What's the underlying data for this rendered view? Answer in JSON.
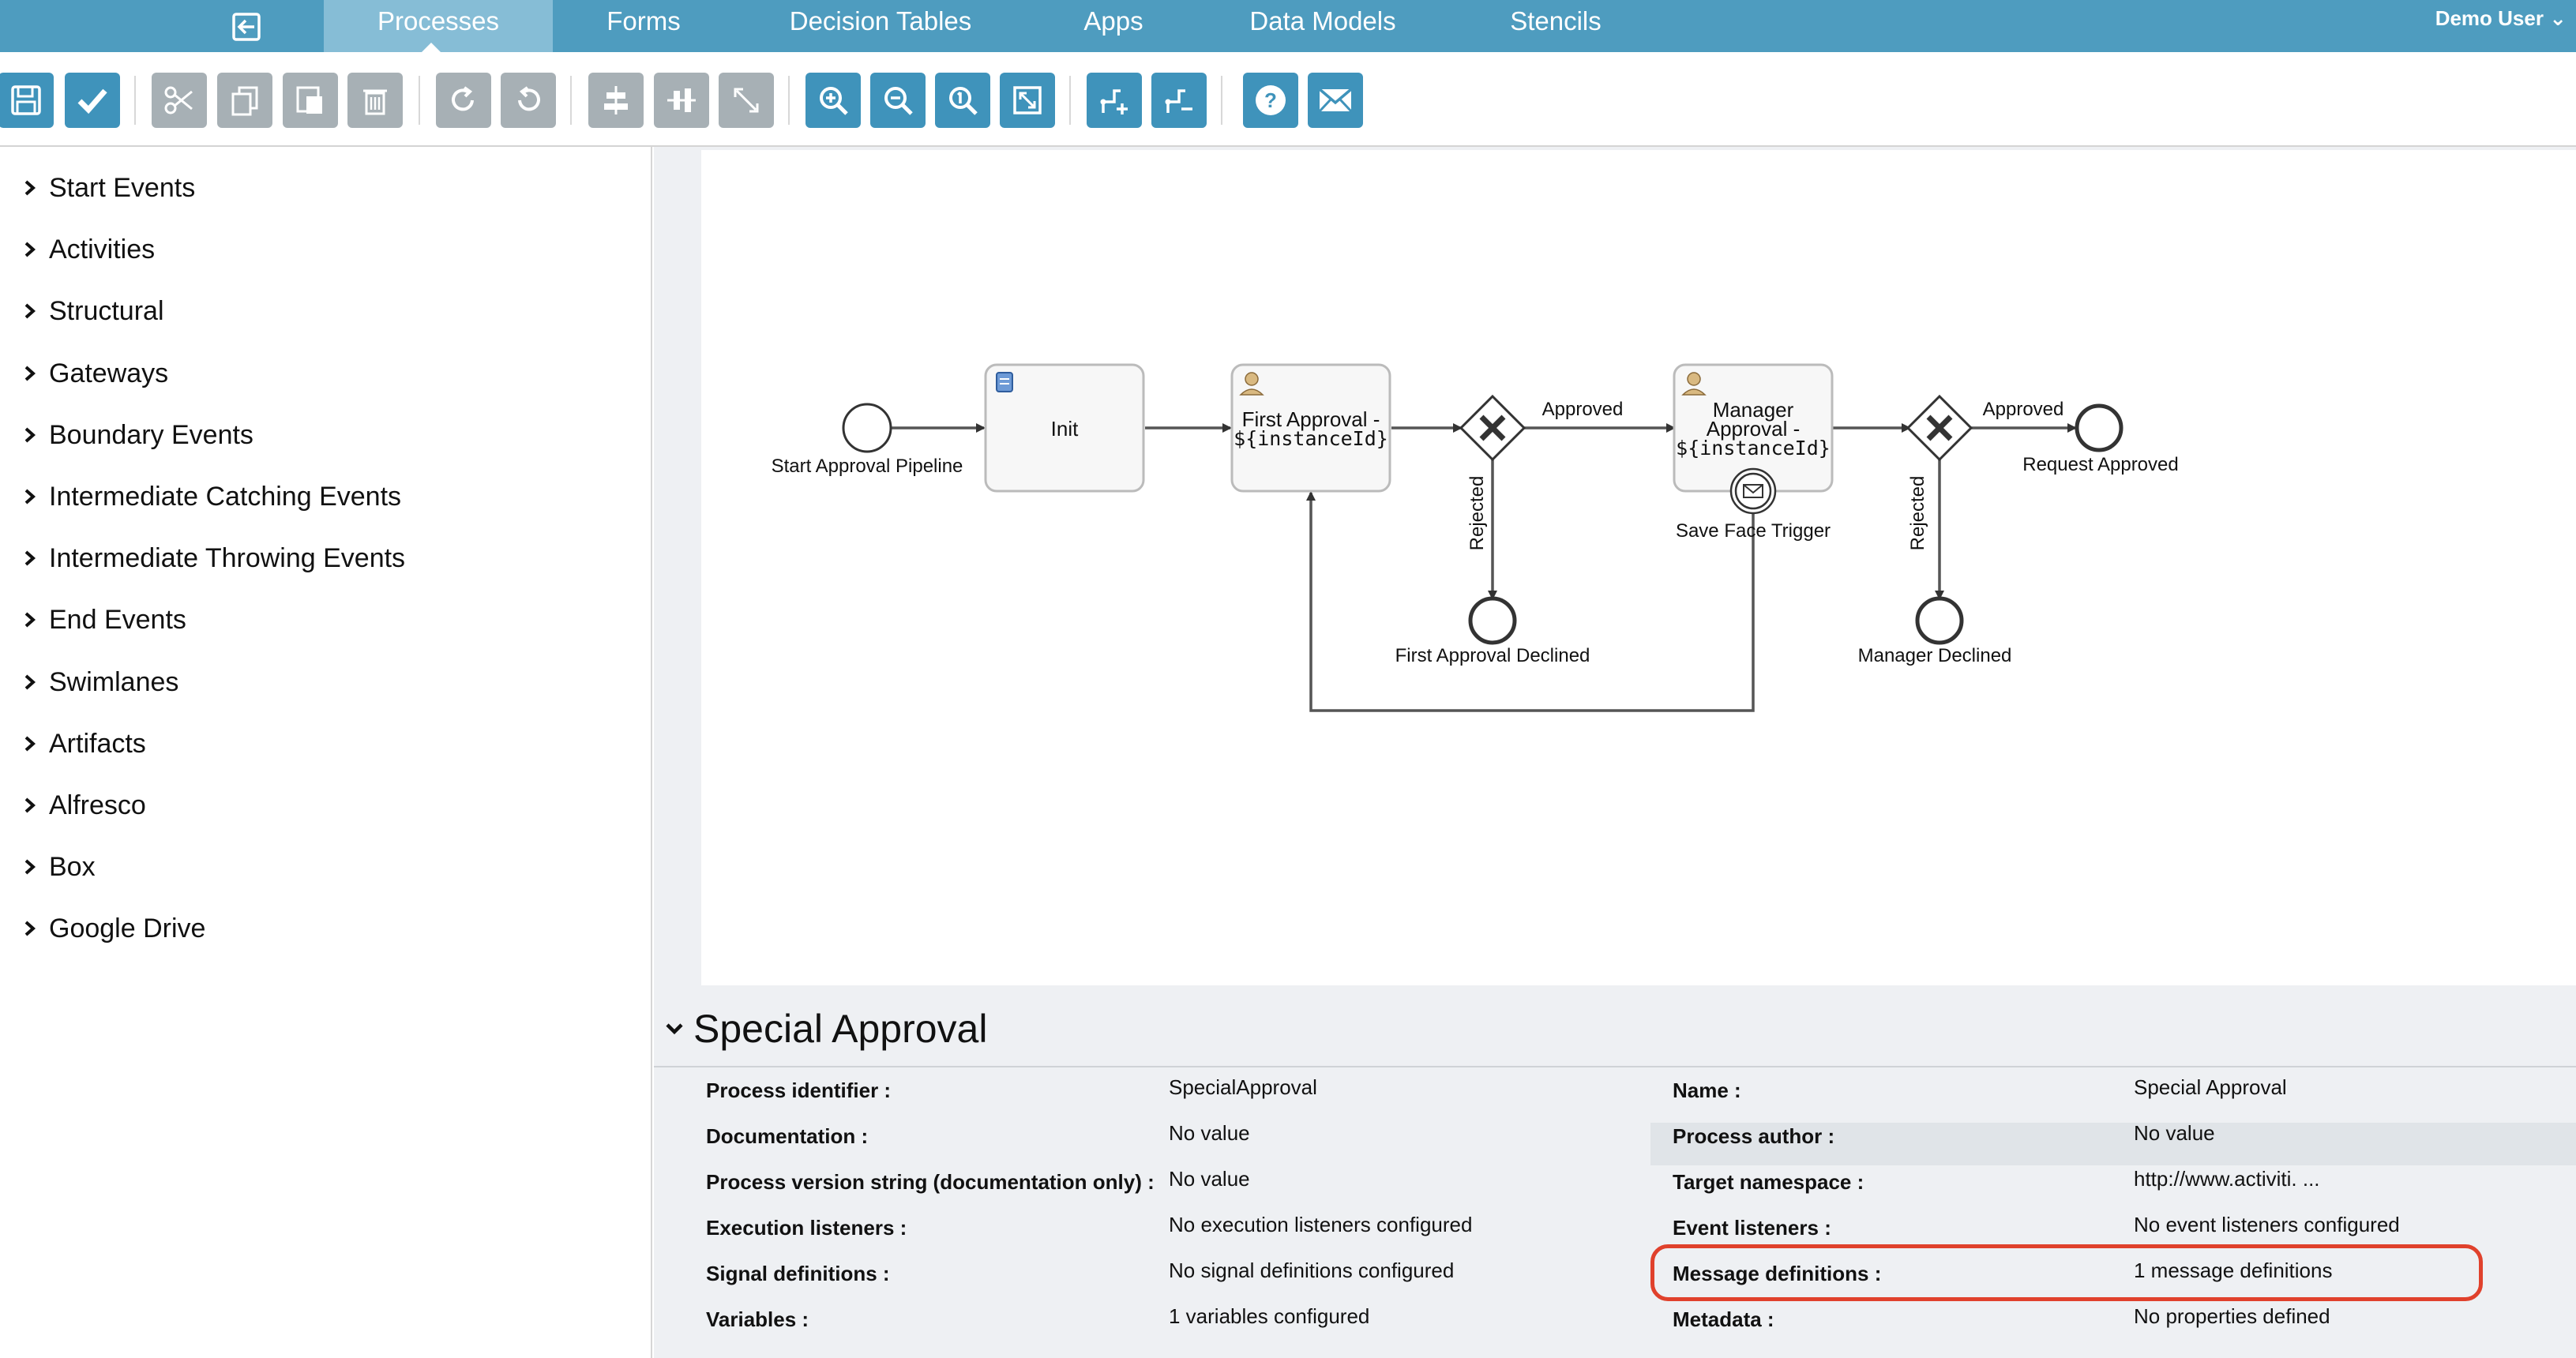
{
  "nav": {
    "tabs": [
      {
        "label": "Processes",
        "active": true
      },
      {
        "label": "Forms"
      },
      {
        "label": "Decision Tables"
      },
      {
        "label": "Apps"
      },
      {
        "label": "Data Models"
      },
      {
        "label": "Stencils"
      }
    ],
    "user": "Demo User"
  },
  "toolbar": {
    "buttons": [
      {
        "icon": "save-icon"
      },
      {
        "icon": "checkmark-icon"
      },
      {
        "icon": "scissors-icon"
      },
      {
        "icon": "copy-icon"
      },
      {
        "icon": "paste-icon"
      },
      {
        "icon": "trash-icon"
      },
      {
        "icon": "redo-icon"
      },
      {
        "icon": "undo-icon"
      },
      {
        "icon": "align-horizontal-icon"
      },
      {
        "icon": "align-vertical-icon"
      },
      {
        "icon": "resize-icon"
      },
      {
        "icon": "zoom-in-icon"
      },
      {
        "icon": "zoom-out-icon"
      },
      {
        "icon": "zoom-actual-icon"
      },
      {
        "icon": "zoom-fit-icon"
      },
      {
        "icon": "add-bendpoint-icon"
      },
      {
        "icon": "remove-bendpoint-icon"
      },
      {
        "icon": "help-icon"
      },
      {
        "icon": "feedback-mail-icon"
      }
    ]
  },
  "palette": {
    "items": [
      "Start Events",
      "Activities",
      "Structural",
      "Gateways",
      "Boundary Events",
      "Intermediate Catching Events",
      "Intermediate Throwing Events",
      "End Events",
      "Swimlanes",
      "Artifacts",
      "Alfresco",
      "Box",
      "Google Drive"
    ]
  },
  "diagram": {
    "start_event": "Start Approval Pipeline",
    "init_task": "Init",
    "first_approval_line1": "First Approval -",
    "first_approval_line2": "${instanceId}",
    "manager_approval_line1": "Manager",
    "manager_approval_line2": "Approval -",
    "manager_approval_line3": "${instanceId}",
    "boundary_event": "Save Face Trigger",
    "approved_1": "Approved",
    "rejected_1": "Rejected",
    "first_declined": "First Approval Declined",
    "approved_2": "Approved",
    "rejected_2": "Rejected",
    "request_approved": "Request Approved",
    "manager_declined": "Manager Declined"
  },
  "properties": {
    "title": "Special Approval",
    "left": [
      {
        "label": "Process identifier :",
        "value": "SpecialApproval"
      },
      {
        "label": "Documentation :",
        "value": "No value"
      },
      {
        "label": "Process version string (documentation only) :",
        "value": "No value"
      },
      {
        "label": "Execution listeners :",
        "value": "No execution listeners configured"
      },
      {
        "label": "Signal definitions :",
        "value": "No signal definitions configured"
      },
      {
        "label": "Variables :",
        "value": "1 variables configured"
      }
    ],
    "right": [
      {
        "label": "Name :",
        "value": "Special Approval"
      },
      {
        "label": "Process author :",
        "value": "No value"
      },
      {
        "label": "Target namespace :",
        "value": "http://www.activiti. ..."
      },
      {
        "label": "Event listeners :",
        "value": "No event listeners configured"
      },
      {
        "label": "Message definitions :",
        "value": "1 message definitions"
      },
      {
        "label": "Metadata :",
        "value": "No properties defined"
      }
    ]
  },
  "colors": {
    "nav": "#4e9cbf",
    "active_tab": "#86bdd6",
    "button_blue": "#3f93bb",
    "button_grey": "#a7b0b5",
    "highlight": "#e0412c"
  }
}
